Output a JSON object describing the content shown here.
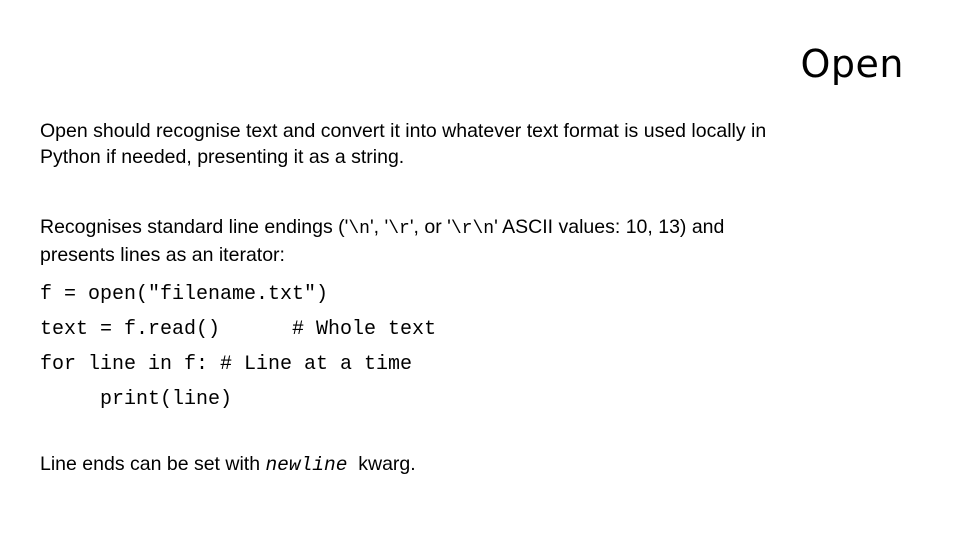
{
  "slide": {
    "title": "Open",
    "paragraph1": {
      "line1": "Open should recognise text and convert it into whatever text format is used locally in",
      "line2": "Python if needed, presenting it as a string."
    },
    "paragraph2": {
      "prefix": "Recognises standard line endings ('",
      "code_n": "\\n",
      "sep1": "', '",
      "code_r": "\\r",
      "sep2": "', or '",
      "code_rn": "\\r\\n",
      "suffix": "' ASCII values: 10, 13)  and",
      "line2": "presents lines as an iterator:"
    },
    "code": [
      "f = open(\"filename.txt\")",
      "text = f.read()      # Whole text",
      "for line in f: # Line at a time",
      "     print(line)"
    ],
    "paragraph3": {
      "prefix": "Line ends can be set with ",
      "keyword": "newline",
      "suffix": "  kwarg."
    }
  }
}
